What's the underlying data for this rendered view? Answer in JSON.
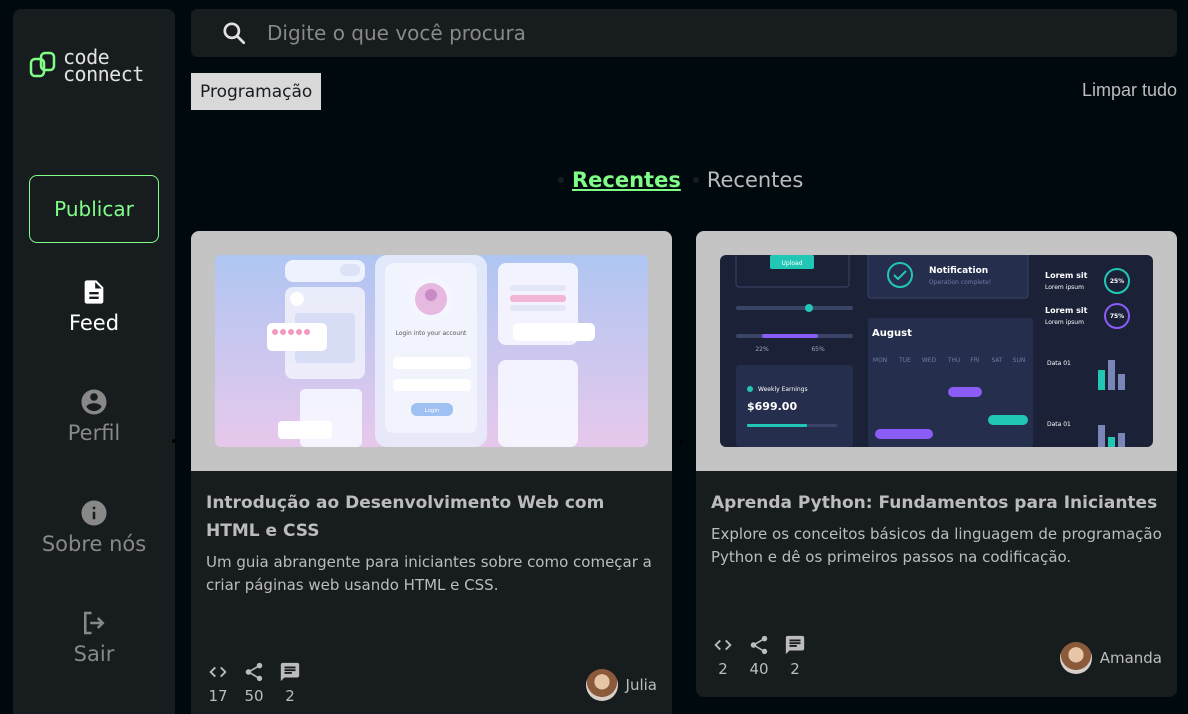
{
  "sidebar": {
    "logo_line1": "code",
    "logo_line2": "connect",
    "publish_label": "Publicar",
    "nav": [
      {
        "label": "Feed",
        "icon": "document-icon"
      },
      {
        "label": "Perfil",
        "icon": "account-circle-icon"
      },
      {
        "label": "Sobre nós",
        "icon": "info-icon"
      },
      {
        "label": "Sair",
        "icon": "logout-icon"
      }
    ]
  },
  "search": {
    "placeholder": "Digite o que você procura"
  },
  "filters": {
    "tag": "Programação",
    "clear_label": "Limpar tudo"
  },
  "tabs": {
    "active": "Recentes",
    "inactive": "Recentes"
  },
  "cards": [
    {
      "title": "Introdução ao Desenvolvimento Web com HTML e CSS",
      "description": "Um guia abrangente para iniciantes sobre como começar a criar páginas web usando HTML e CSS.",
      "code_count": "17",
      "share_count": "50",
      "comment_count": "2",
      "author": "Julia"
    },
    {
      "title": "Aprenda Python: Fundamentos para Iniciantes",
      "description": "Explore os conceitos básicos da linguagem de programação Python e dê os primeiros passos na codificação.",
      "code_count": "2",
      "share_count": "40",
      "comment_count": "2",
      "author": "Amanda"
    }
  ],
  "thumb2": {
    "upload": "Upload",
    "notification_title": "Notification",
    "notification_sub": "Operation complete!",
    "slider_left": "22%",
    "slider_right": "65%",
    "month": "August",
    "weekdays": [
      "MON",
      "TUE",
      "WED",
      "THU",
      "FRI",
      "SAT",
      "SUN"
    ],
    "weekly_label": "Weekly Earnings",
    "amount": "$699.00",
    "lorem_title": "Lorem sit",
    "lorem_sub": "Lorem ipsum",
    "pct1": "25%",
    "pct2": "75%",
    "data_label": "Data 01"
  },
  "thumb1": {
    "login_title": "Login into your account",
    "login_btn": "Login"
  },
  "colors": {
    "accent": "#81FE88",
    "bg": "#00090E",
    "surface": "#171D1F"
  }
}
